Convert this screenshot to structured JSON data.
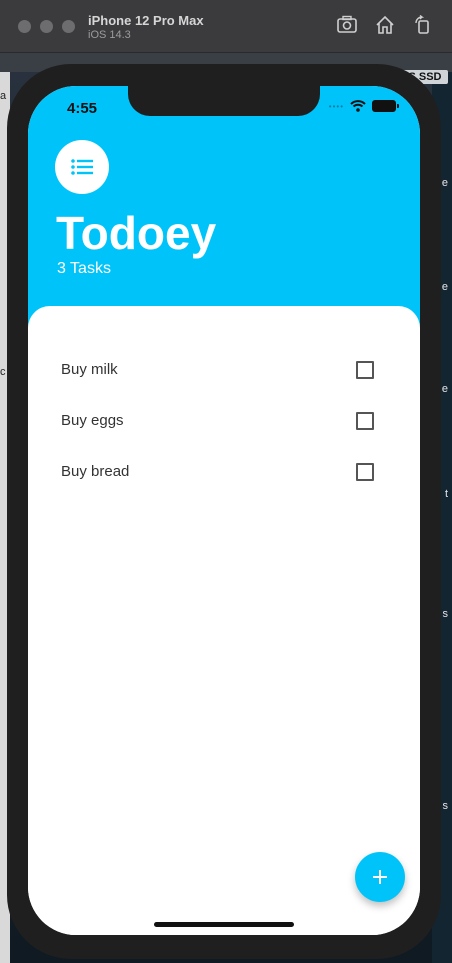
{
  "window": {
    "title": "iPhone 12 Pro Max",
    "subtitle": "iOS 14.3"
  },
  "desktop": {
    "ssd_badge": "S SSD",
    "right_edge_labels": [
      "e",
      "e",
      "e",
      "t",
      "s",
      "s"
    ],
    "left_edge_labels": [
      "a",
      "c"
    ]
  },
  "status_bar": {
    "time": "4:55"
  },
  "app": {
    "title": "Todoey",
    "task_count_text": "3 Tasks",
    "accent_color": "#00c4f9",
    "tasks": [
      {
        "title": "Buy milk",
        "checked": false
      },
      {
        "title": "Buy eggs",
        "checked": false
      },
      {
        "title": "Buy bread",
        "checked": false
      }
    ],
    "add_button_icon": "plus-icon"
  },
  "icons": {
    "menu": "list-icon",
    "screenshot": "camera-icon",
    "home": "home-icon",
    "rotate": "rotate-icon",
    "wifi": "wifi-icon",
    "battery": "battery-icon"
  }
}
